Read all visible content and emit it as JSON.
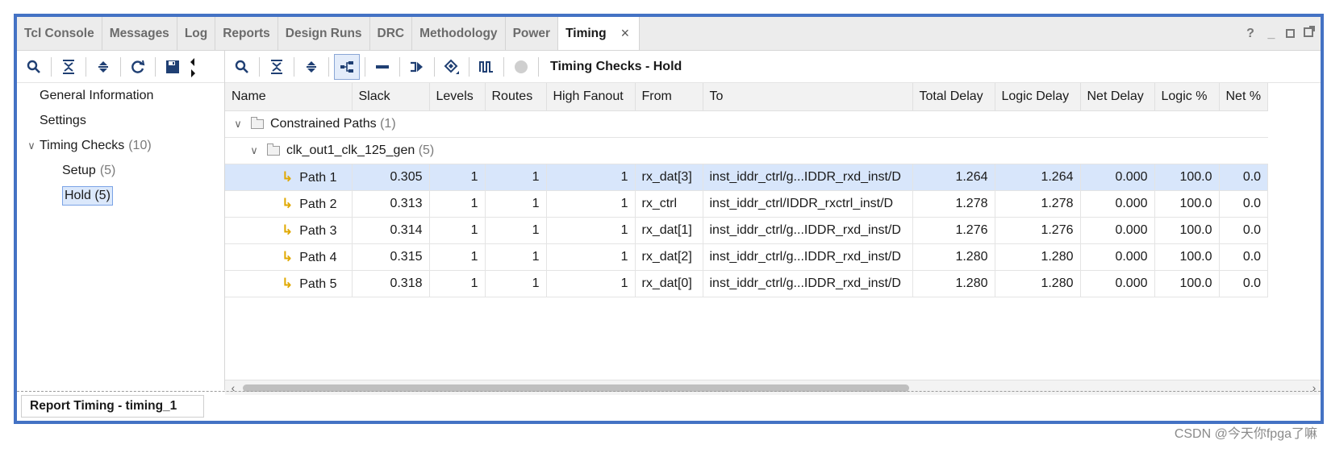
{
  "tabs": [
    {
      "label": "Tcl Console"
    },
    {
      "label": "Messages"
    },
    {
      "label": "Log"
    },
    {
      "label": "Reports"
    },
    {
      "label": "Design Runs"
    },
    {
      "label": "DRC"
    },
    {
      "label": "Methodology"
    },
    {
      "label": "Power"
    },
    {
      "label": "Timing",
      "active": true
    }
  ],
  "window_controls": {
    "help": "?",
    "minimize": "_"
  },
  "tab_close": "×",
  "left": {
    "general_information": "General Information",
    "settings": "Settings",
    "timing_checks": "Timing Checks",
    "timing_checks_count": "(10)",
    "setup": "Setup",
    "setup_count": "(5)",
    "hold": "Hold (5)"
  },
  "right": {
    "title": "Timing Checks - Hold",
    "columns": [
      "Name",
      "Slack",
      "Levels",
      "Routes",
      "High Fanout",
      "From",
      "To",
      "Total Delay",
      "Logic Delay",
      "Net Delay",
      "Logic %",
      "Net %"
    ],
    "group1_label": "Constrained Paths",
    "group1_count": "(1)",
    "group2_label": "clk_out1_clk_125_gen",
    "group2_count": "(5)",
    "rows": [
      {
        "name": "Path 1",
        "slack": "0.305",
        "levels": "1",
        "routes": "1",
        "fanout": "1",
        "from": "rx_dat[3]",
        "to": "inst_iddr_ctrl/g...IDDR_rxd_inst/D",
        "total": "1.264",
        "logic": "1.264",
        "net": "0.000",
        "logic_pct": "100.0",
        "net_pct": "0.0"
      },
      {
        "name": "Path 2",
        "slack": "0.313",
        "levels": "1",
        "routes": "1",
        "fanout": "1",
        "from": "rx_ctrl",
        "to": "inst_iddr_ctrl/IDDR_rxctrl_inst/D",
        "total": "1.278",
        "logic": "1.278",
        "net": "0.000",
        "logic_pct": "100.0",
        "net_pct": "0.0"
      },
      {
        "name": "Path 3",
        "slack": "0.314",
        "levels": "1",
        "routes": "1",
        "fanout": "1",
        "from": "rx_dat[1]",
        "to": "inst_iddr_ctrl/g...IDDR_rxd_inst/D",
        "total": "1.276",
        "logic": "1.276",
        "net": "0.000",
        "logic_pct": "100.0",
        "net_pct": "0.0"
      },
      {
        "name": "Path 4",
        "slack": "0.315",
        "levels": "1",
        "routes": "1",
        "fanout": "1",
        "from": "rx_dat[2]",
        "to": "inst_iddr_ctrl/g...IDDR_rxd_inst/D",
        "total": "1.280",
        "logic": "1.280",
        "net": "0.000",
        "logic_pct": "100.0",
        "net_pct": "0.0"
      },
      {
        "name": "Path 5",
        "slack": "0.318",
        "levels": "1",
        "routes": "1",
        "fanout": "1",
        "from": "rx_dat[0]",
        "to": "inst_iddr_ctrl/g...IDDR_rxd_inst/D",
        "total": "1.280",
        "logic": "1.280",
        "net": "0.000",
        "logic_pct": "100.0",
        "net_pct": "0.0"
      }
    ]
  },
  "bottom_tab": "Report Timing - timing_1",
  "watermark": "CSDN @今天你fpga了嘛",
  "colors": {
    "frame": "#4472c4",
    "selection": "#d8e6fb",
    "icon_blue": "#1f3f73",
    "path_icon": "#e0a800"
  }
}
